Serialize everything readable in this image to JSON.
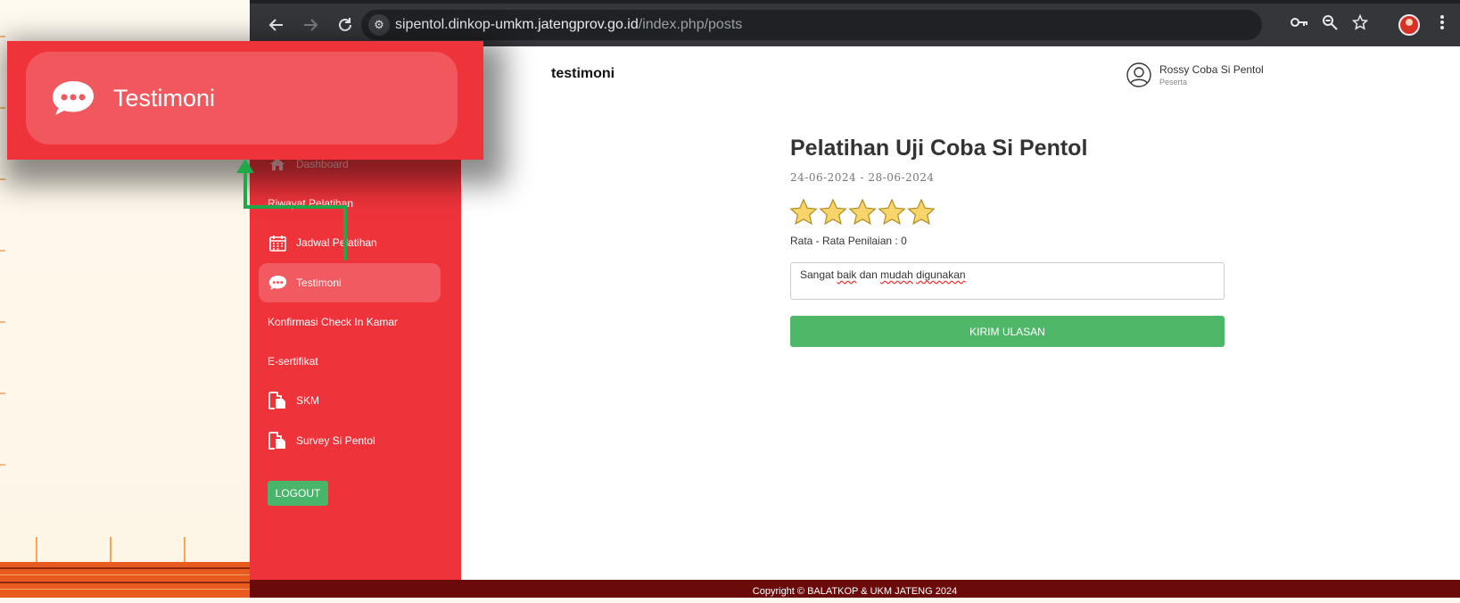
{
  "browser": {
    "url_host": "sipentol.dinkop-umkm.jatengprov.go.id",
    "url_path": "/index.php/posts"
  },
  "sidebar": {
    "items": [
      {
        "label": "Dashboard",
        "icon": "home-icon"
      },
      {
        "label": "Riwayat Pelatihan",
        "icon": ""
      },
      {
        "label": "Jadwal Pelatihan",
        "icon": "calendar-icon"
      },
      {
        "label": "Testimoni",
        "icon": "chat-icon"
      },
      {
        "label": "Konfirmasi Check In Kamar",
        "icon": ""
      },
      {
        "label": "E-sertifikat",
        "icon": ""
      },
      {
        "label": "SKM",
        "icon": "document-icon"
      },
      {
        "label": "Survey Si Pentol",
        "icon": "document-icon"
      }
    ],
    "logout_label": "LOGOUT",
    "accent_color": "#ef333b"
  },
  "header": {
    "page_title": "testimoni",
    "user_name": "Rossy Coba Si Pentol",
    "user_role": "Peserta"
  },
  "course": {
    "title": "Pelatihan Uji Coba Si Pentol",
    "dates": "24-06-2024 - 28-06-2024",
    "star_count": 5,
    "rating_text": "Rata - Rata Penilaian : 0",
    "review_words": [
      "Sangat",
      "baik",
      "dan",
      "mudah",
      "digunakan"
    ],
    "submit_label": "KIRIM ULASAN",
    "submit_color": "#4eb868"
  },
  "footer": {
    "copyright": "Copyright © BALATKOP & UKM JATENG 2024"
  },
  "callout": {
    "label": "Testimoni",
    "icon": "chat-icon"
  }
}
